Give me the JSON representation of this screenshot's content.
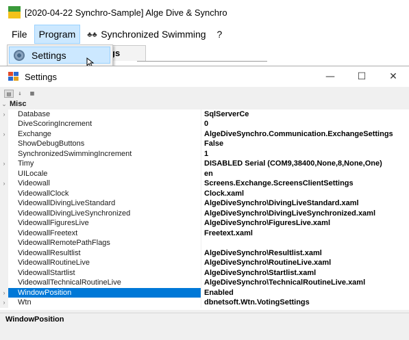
{
  "app": {
    "title": "[2020-04-22 Synchro-Sample] Alge Dive & Synchro",
    "icon": "alge-app-icon"
  },
  "menu": {
    "file": "File",
    "program": "Program",
    "synchronized": "Synchronized Swimming",
    "help": "?"
  },
  "dropdown": {
    "settings": "Settings"
  },
  "tab": {
    "partial_label": "gs"
  },
  "dialog": {
    "title": "Settings",
    "minimize": "—",
    "maximize": "☐",
    "close": "✕"
  },
  "grid": {
    "category": "Misc",
    "rows": [
      {
        "name": "Database",
        "value": "SqlServerCe",
        "expandable": true
      },
      {
        "name": "DiveScoringIncrement",
        "value": "0",
        "expandable": false
      },
      {
        "name": "Exchange",
        "value": "AlgeDiveSynchro.Communication.ExchangeSettings",
        "expandable": true
      },
      {
        "name": "ShowDebugButtons",
        "value": "False",
        "expandable": false
      },
      {
        "name": "SynchronizedSwimmingIncrement",
        "value": "1",
        "expandable": false
      },
      {
        "name": "Timy",
        "value": "DISABLED Serial (COM9,38400,None,8,None,One)",
        "expandable": true
      },
      {
        "name": "UILocale",
        "value": "en",
        "expandable": false
      },
      {
        "name": "Videowall",
        "value": "Screens.Exchange.ScreensClientSettings",
        "expandable": true
      },
      {
        "name": "VideowallClock",
        "value": "Clock.xaml",
        "expandable": false
      },
      {
        "name": "VideowallDivingLiveStandard",
        "value": "AlgeDiveSynchro\\DivingLiveStandard.xaml",
        "expandable": false
      },
      {
        "name": "VideowallDivingLiveSynchronized",
        "value": "AlgeDiveSynchro\\DivingLiveSynchronized.xaml",
        "expandable": false
      },
      {
        "name": "VideowallFiguresLive",
        "value": "AlgeDiveSynchro\\FiguresLive.xaml",
        "expandable": false
      },
      {
        "name": "VideowallFreetext",
        "value": "Freetext.xaml",
        "expandable": false
      },
      {
        "name": "VideowallRemotePathFlags",
        "value": "",
        "expandable": false
      },
      {
        "name": "VideowallResultlist",
        "value": "AlgeDiveSynchro\\Resultlist.xaml",
        "expandable": false
      },
      {
        "name": "VideowallRoutineLive",
        "value": "AlgeDiveSynchro\\RoutineLive.xaml",
        "expandable": false
      },
      {
        "name": "VideowallStartlist",
        "value": "AlgeDiveSynchro\\Startlist.xaml",
        "expandable": false
      },
      {
        "name": "VideowallTechnicalRoutineLive",
        "value": "AlgeDiveSynchro\\TechnicalRoutineLive.xaml",
        "expandable": false
      },
      {
        "name": "WindowPosition",
        "value": "Enabled",
        "expandable": true,
        "selected": true
      },
      {
        "name": "Wtn",
        "value": "dbnetsoft.Wtn.VotingSettings",
        "expandable": true
      }
    ]
  },
  "description": {
    "title": "WindowPosition"
  },
  "colors": {
    "selection": "#0078d7",
    "menu_highlight": "#cce8ff"
  }
}
